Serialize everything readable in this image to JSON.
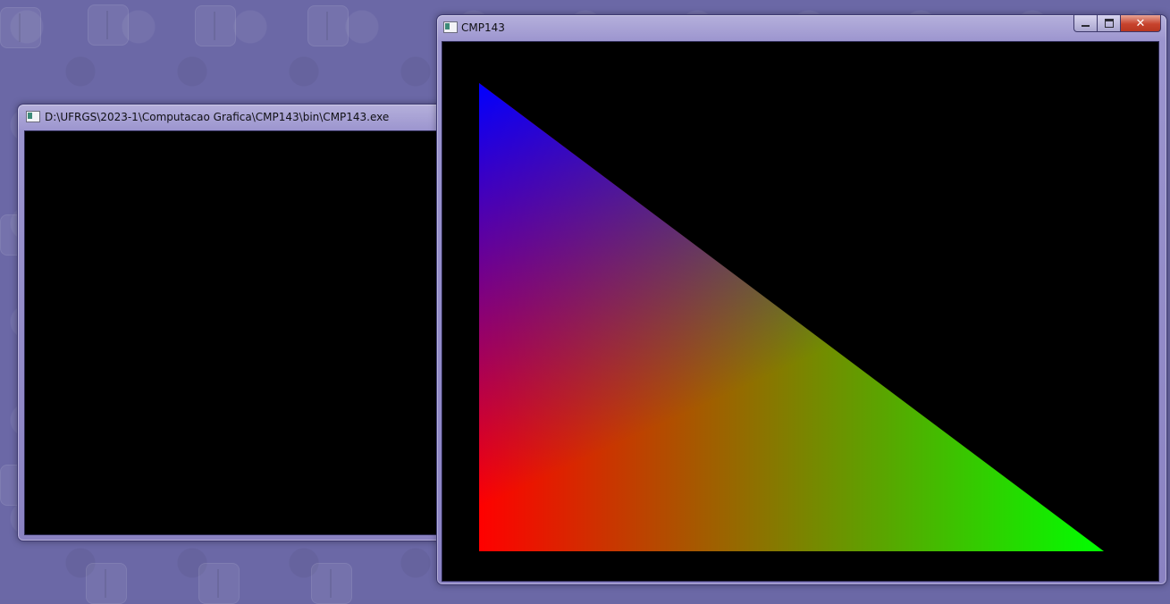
{
  "desktop": {
    "wallpaper_color": "#6b68a6"
  },
  "console_window": {
    "title": "D:\\UFRGS\\2023-1\\Computacao Grafica\\CMP143\\bin\\CMP143.exe",
    "icon": "console-app-icon"
  },
  "gl_window": {
    "title": "CMP143",
    "icon": "app-icon",
    "controls": {
      "minimize_icon": "minimize-icon",
      "maximize_icon": "maximize-icon",
      "close_icon": "close-icon",
      "close_label": "✕"
    },
    "triangle": {
      "vertex_colors": [
        "#0000ff",
        "#ff0000",
        "#00ff00"
      ]
    }
  }
}
